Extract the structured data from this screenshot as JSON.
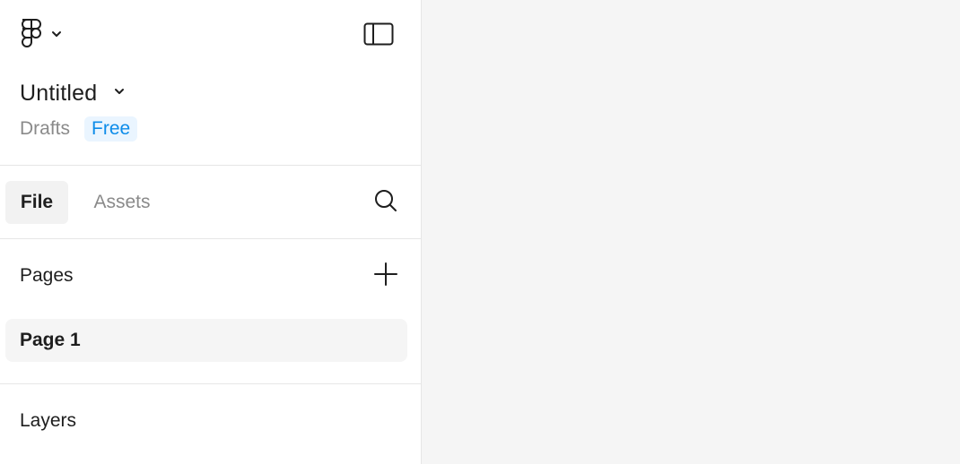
{
  "header": {
    "logo_icon": "figma-logo-icon",
    "menu_chevron_icon": "chevron-down-icon",
    "panel_toggle_icon": "sidebar-panel-icon"
  },
  "file": {
    "title": "Untitled",
    "title_chevron_icon": "chevron-down-icon",
    "location": "Drafts",
    "plan": "Free"
  },
  "tabs": [
    {
      "label": "File",
      "active": true
    },
    {
      "label": "Assets",
      "active": false
    }
  ],
  "search_icon": "search-icon",
  "pages": {
    "title": "Pages",
    "add_icon": "plus-icon",
    "items": [
      {
        "label": "Page 1",
        "selected": true
      }
    ]
  },
  "layers": {
    "title": "Layers"
  },
  "colors": {
    "accent": "#0d8ce9",
    "accent_bg": "#eaf5ff",
    "canvas_bg": "#f5f5f5",
    "text_primary": "#1e1e1e",
    "text_secondary": "#8a8a8a"
  }
}
